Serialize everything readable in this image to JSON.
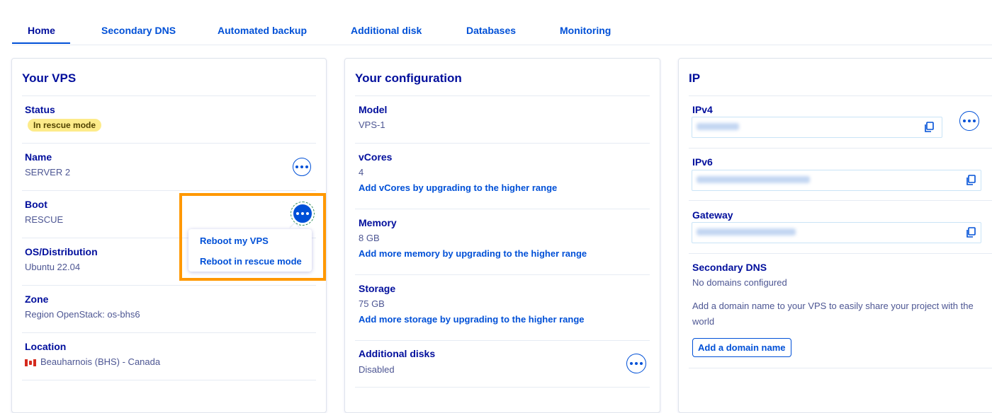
{
  "tabs": [
    {
      "label": "Home"
    },
    {
      "label": "Secondary DNS"
    },
    {
      "label": "Automated backup"
    },
    {
      "label": "Additional disk"
    },
    {
      "label": "Databases"
    },
    {
      "label": "Monitoring"
    }
  ],
  "vps": {
    "title": "Your VPS",
    "status_label": "Status",
    "status_badge": "In rescue mode",
    "name_label": "Name",
    "name_value": "SERVER 2",
    "boot_label": "Boot",
    "boot_value": "RESCUE",
    "os_label": "OS/Distribution",
    "os_value": "Ubuntu 22.04",
    "zone_label": "Zone",
    "zone_value": "Region OpenStack: os-bhs6",
    "location_label": "Location",
    "location_value": "Beauharnois (BHS) - Canada",
    "boot_menu": [
      "Reboot my VPS",
      "Reboot in rescue mode"
    ]
  },
  "config": {
    "title": "Your configuration",
    "model_label": "Model",
    "model_value": "VPS-1",
    "vcores_label": "vCores",
    "vcores_value": "4",
    "vcores_link": "Add vCores by upgrading to the higher range",
    "memory_label": "Memory",
    "memory_value": "8 GB",
    "memory_link": "Add more memory by upgrading to the higher range",
    "storage_label": "Storage",
    "storage_value": "75 GB",
    "storage_link": "Add more storage by upgrading to the higher range",
    "disks_label": "Additional disks",
    "disks_value": "Disabled"
  },
  "ip": {
    "title": "IP",
    "ipv4_label": "IPv4",
    "ipv6_label": "IPv6",
    "gateway_label": "Gateway",
    "dns_label": "Secondary DNS",
    "dns_value": "No domains configured",
    "dns_help": "Add a domain name to your VPS to easily share your project with the world",
    "add_domain_button": "Add a domain name"
  },
  "colors": {
    "accent": "#0050d7",
    "heading": "#000e9c",
    "badge_bg": "#fdeb8a",
    "highlight": "#ff9800"
  }
}
